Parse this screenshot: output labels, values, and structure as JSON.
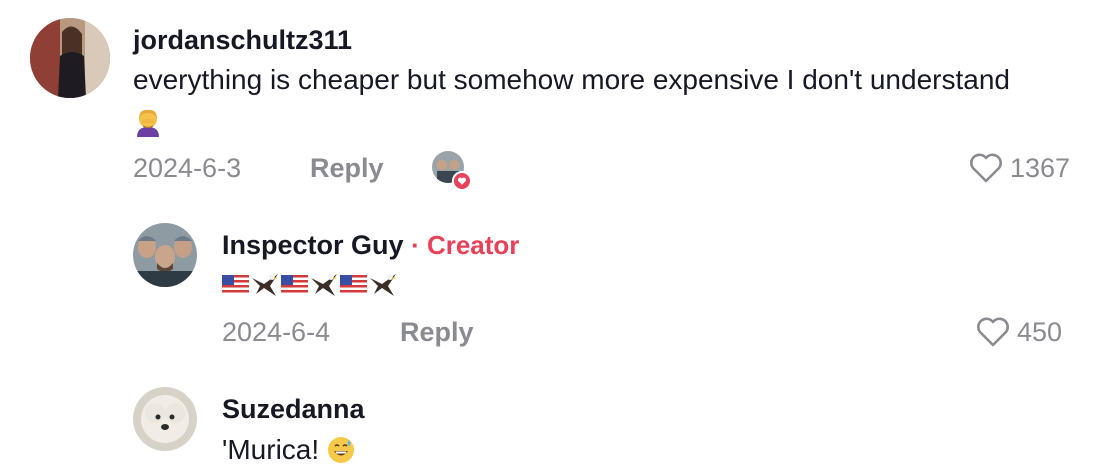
{
  "comments": [
    {
      "username": "jordanschultz311",
      "text": "everything is cheaper but somehow more expensive I don't understand",
      "emoji_icon": "woman-facepalming-emoji",
      "date": "2024-6-3",
      "reply_label": "Reply",
      "likes": "1367",
      "creator_liked": true
    },
    {
      "username": "Inspector Guy",
      "creator_badge": "· Creator",
      "text_icons": [
        "us-flag-emoji",
        "eagle-emoji",
        "us-flag-emoji",
        "eagle-emoji",
        "us-flag-emoji",
        "eagle-emoji"
      ],
      "date": "2024-6-4",
      "reply_label": "Reply",
      "likes": "450"
    },
    {
      "username": "Suzedanna",
      "text": "'Murica!",
      "emoji_icon": "grinning-sweat-emoji"
    }
  ],
  "colors": {
    "accent": "#e8415a",
    "meta": "#8a8b91",
    "text": "#161823"
  }
}
